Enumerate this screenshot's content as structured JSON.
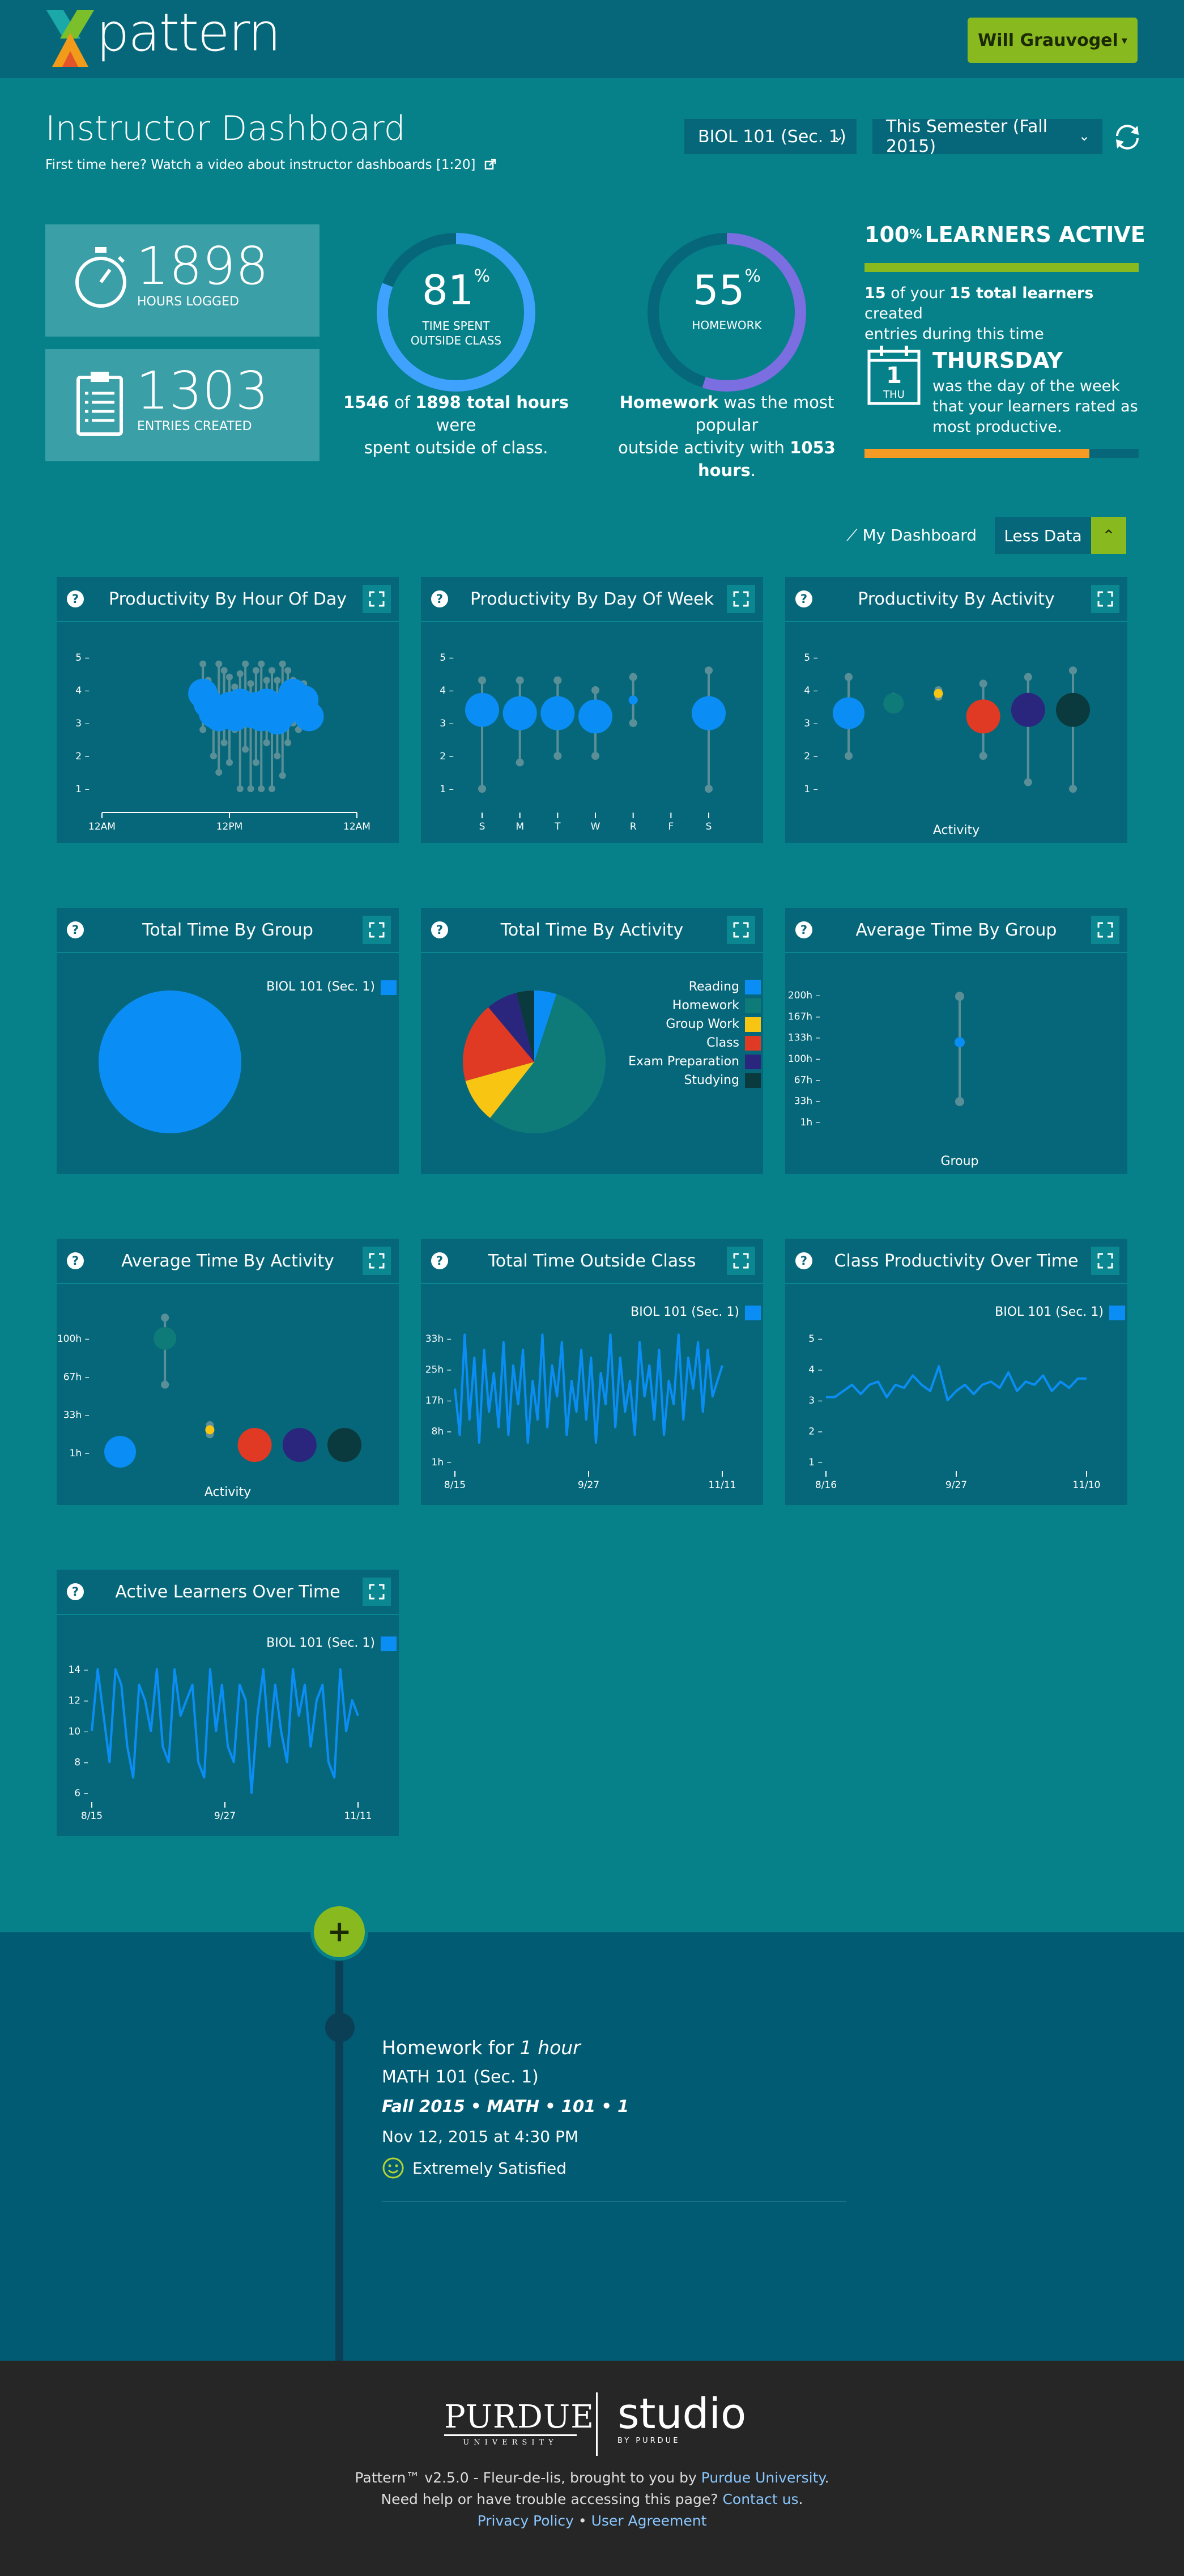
{
  "header": {
    "logo_text": "pattern",
    "user_label": "Will Grauvogel"
  },
  "page": {
    "title": "Instructor Dashboard",
    "subtitle": "First time here? Watch a video about instructor dashboards [1:20]",
    "course_select": "BIOL 101 (Sec. 1)",
    "semester_select": "This Semester (Fall 2015)"
  },
  "stats": {
    "hours_value": "1898",
    "hours_label": "HOURS LOGGED",
    "entries_value": "1303",
    "entries_label": "ENTRIES CREATED"
  },
  "donut_outside": {
    "value": "81",
    "percent": "%",
    "label_line1": "TIME SPENT",
    "label_line2": "OUTSIDE CLASS",
    "fraction": 0.81,
    "color": "#3fa2ff",
    "desc_a": "1546",
    "desc_b": " of ",
    "desc_c": "1898 total hours",
    "desc_d": " were",
    "desc_line2": "spent outside of class."
  },
  "donut_homework": {
    "value": "55",
    "percent": "%",
    "label": "HOMEWORK",
    "fraction": 0.55,
    "color": "#7a6ee0",
    "desc_a": "Homework",
    "desc_b": " was the most popular",
    "desc_c": "outside activity with ",
    "desc_d": "1053 hours",
    "desc_e": "."
  },
  "learners": {
    "pct": "100",
    "pct_sign": "%",
    "heading": "LEARNERS ACTIVE",
    "fraction": 1.0,
    "desc_a": "15",
    "desc_b": " of your ",
    "desc_c": "15 total learners",
    "desc_d": " created",
    "desc_line2": "entries during this time"
  },
  "weekday": {
    "cal_day": "1",
    "cal_label": "THU",
    "heading": "THURSDAY",
    "desc": "was the day of the week that your learners rated as most productive.",
    "fraction": 0.82
  },
  "controls": {
    "my_dashboard": "My Dashboard",
    "less_data": "Less Data",
    "collapse_icon": "chevron-up-icon"
  },
  "cards": {
    "hour": {
      "title": "Productivity By Hour Of Day",
      "yticks": [
        "5 –",
        "4 –",
        "3 –",
        "2 –",
        "1 –"
      ],
      "xticks": [
        "12AM",
        "12PM",
        "12AM"
      ]
    },
    "dow": {
      "title": "Productivity By Day Of Week",
      "yticks": [
        "5 –",
        "4 –",
        "3 –",
        "2 –",
        "1 –"
      ],
      "xticks": [
        "S",
        "M",
        "T",
        "W",
        "R",
        "F",
        "S"
      ]
    },
    "activity": {
      "title": "Productivity By Activity",
      "yticks": [
        "5 –",
        "4 –",
        "3 –",
        "2 –",
        "1 –"
      ],
      "xlabel": "Activity"
    },
    "ttgroup": {
      "title": "Total Time By Group",
      "legend": "BIOL 101 (Sec. 1)"
    },
    "ttactivity": {
      "title": "Total Time By Activity",
      "legend": [
        "Reading",
        "Homework",
        "Group Work",
        "Class",
        "Exam Preparation",
        "Studying"
      ]
    },
    "atgroup": {
      "title": "Average Time By Group",
      "yticks": [
        "200h –",
        "167h –",
        "133h –",
        "100h –",
        "67h –",
        "33h –",
        "1h –"
      ],
      "xlabel": "Group"
    },
    "atactivity": {
      "title": "Average Time By Activity",
      "yticks": [
        "100h –",
        "67h –",
        "33h –",
        "1h –"
      ],
      "xlabel": "Activity"
    },
    "ttoutside": {
      "title": "Total Time Outside Class",
      "legend": "BIOL 101 (Sec. 1)",
      "yticks": [
        "33h –",
        "25h –",
        "17h –",
        "8h –",
        "1h –"
      ],
      "xticks": [
        "8/15",
        "9/27",
        "11/11"
      ]
    },
    "productivity_time": {
      "title": "Class Productivity Over Time",
      "legend": "BIOL 101 (Sec. 1)",
      "yticks": [
        "5 –",
        "4 –",
        "3 –",
        "2 –",
        "1 –"
      ],
      "xticks": [
        "8/16",
        "9/27",
        "11/10"
      ]
    },
    "active_learners": {
      "title": "Active Learners Over Time",
      "legend": "BIOL 101 (Sec. 1)",
      "yticks": [
        "14 –",
        "12 –",
        "10 –",
        "8 –",
        "6 –"
      ],
      "xticks": [
        "8/15",
        "9/27",
        "11/11"
      ]
    }
  },
  "colors": {
    "reading": "#0a8ef5",
    "homework": "#0e7b79",
    "group_work": "#f8c513",
    "class": "#e03a24",
    "exam_prep": "#2a267e",
    "studying": "#0b3a3e",
    "accent_green": "#88b91f",
    "accent_orange": "#f59a23"
  },
  "chart_data": [
    {
      "type": "scatter",
      "title": "Productivity By Hour Of Day",
      "ylim": [
        1,
        5
      ],
      "x_range": [
        0,
        24
      ],
      "points": [
        {
          "x": 9.5,
          "y": 3.9,
          "lo": 2.8,
          "hi": 4.8
        },
        {
          "x": 10,
          "y": 3.6,
          "lo": 3.0,
          "hi": 4.3
        },
        {
          "x": 10.5,
          "y": 3.3,
          "lo": 2.0,
          "hi": 4.0
        },
        {
          "x": 11,
          "y": 3.2,
          "lo": 1.5,
          "hi": 4.8
        },
        {
          "x": 11.5,
          "y": 3.4,
          "lo": 2.4,
          "hi": 4.6
        },
        {
          "x": 12,
          "y": 3.5,
          "lo": 1.8,
          "hi": 4.4
        },
        {
          "x": 12.5,
          "y": 3.2,
          "lo": 2.8,
          "hi": 4.1
        },
        {
          "x": 13,
          "y": 3.6,
          "lo": 1.0,
          "hi": 4.5
        },
        {
          "x": 13.5,
          "y": 3.4,
          "lo": 2.2,
          "hi": 4.8
        },
        {
          "x": 14,
          "y": 3.3,
          "lo": 1.0,
          "hi": 4.2
        },
        {
          "x": 14.5,
          "y": 3.5,
          "lo": 1.8,
          "hi": 4.6
        },
        {
          "x": 15,
          "y": 3.2,
          "lo": 1.0,
          "hi": 4.8
        },
        {
          "x": 15.5,
          "y": 3.6,
          "lo": 2.4,
          "hi": 4.3
        },
        {
          "x": 16,
          "y": 3.4,
          "lo": 1.0,
          "hi": 4.6
        },
        {
          "x": 16.5,
          "y": 3.1,
          "lo": 2.0,
          "hi": 4.3
        },
        {
          "x": 17,
          "y": 3.3,
          "lo": 1.4,
          "hi": 4.8
        },
        {
          "x": 17.5,
          "y": 3.6,
          "lo": 2.4,
          "hi": 4.6
        },
        {
          "x": 18,
          "y": 3.9,
          "lo": 3.0,
          "hi": 4.3
        },
        {
          "x": 18.5,
          "y": 3.5,
          "lo": 2.8,
          "hi": 4.0
        },
        {
          "x": 19,
          "y": 3.7,
          "lo": 3.4,
          "hi": 4.2
        },
        {
          "x": 19.5,
          "y": 3.2,
          "lo": 3.0,
          "hi": 3.9
        }
      ]
    },
    {
      "type": "scatter",
      "title": "Productivity By Day Of Week",
      "categories": [
        "S",
        "M",
        "T",
        "W",
        "R",
        "F",
        "S"
      ],
      "ylim": [
        1,
        5
      ],
      "values": [
        3.4,
        3.3,
        3.3,
        3.2,
        3.7,
        null,
        3.3
      ],
      "lo": [
        1.0,
        1.8,
        2.0,
        2.0,
        3.0,
        null,
        1.0
      ],
      "hi": [
        4.3,
        4.3,
        4.3,
        4.0,
        4.4,
        null,
        4.6
      ]
    },
    {
      "type": "scatter",
      "title": "Productivity By Activity",
      "categories": [
        "Reading",
        "Homework",
        "Group Work",
        "Class",
        "Exam Preparation",
        "Studying"
      ],
      "ylim": [
        1,
        5
      ],
      "values": [
        3.3,
        3.6,
        3.9,
        3.2,
        3.4,
        3.4
      ],
      "lo": [
        2.0,
        3.5,
        3.8,
        2.0,
        1.2,
        1.0
      ],
      "hi": [
        4.4,
        3.8,
        4.0,
        4.2,
        4.4,
        4.6
      ]
    },
    {
      "type": "pie",
      "title": "Total Time By Group",
      "labels": [
        "BIOL 101 (Sec. 1)"
      ],
      "values": [
        1
      ]
    },
    {
      "type": "pie",
      "title": "Total Time By Activity",
      "labels": [
        "Reading",
        "Homework",
        "Group Work",
        "Class",
        "Exam Preparation",
        "Studying"
      ],
      "values": [
        5,
        55,
        10,
        18,
        7,
        4
      ]
    },
    {
      "type": "scatter",
      "title": "Average Time By Group",
      "categories": [
        "Group"
      ],
      "values": [
        126
      ],
      "lo": [
        33
      ],
      "hi": [
        198
      ],
      "ylim": [
        1,
        200
      ]
    },
    {
      "type": "scatter",
      "title": "Average Time By Activity",
      "categories": [
        "Reading",
        "Homework",
        "Group Work",
        "Class",
        "Exam Preparation",
        "Studying"
      ],
      "values": [
        1,
        100,
        21,
        17,
        1,
        1
      ],
      "lo": [
        null,
        60,
        17,
        null,
        null,
        null
      ],
      "hi": [
        null,
        118,
        25,
        null,
        null,
        null
      ],
      "ylim": [
        1,
        110
      ]
    },
    {
      "type": "line",
      "title": "Total Time Outside Class",
      "x_range": [
        "8/15",
        "11/11"
      ],
      "ylim": [
        1,
        36
      ],
      "series": [
        {
          "name": "BIOL 101 (Sec. 1)",
          "values": [
            20,
            8,
            34,
            12,
            28,
            6,
            30,
            14,
            24,
            10,
            32,
            8,
            26,
            16,
            30,
            6,
            22,
            12,
            34,
            10,
            26,
            18,
            32,
            8,
            22,
            14,
            30,
            12,
            28,
            6,
            24,
            16,
            34,
            10,
            28,
            14,
            22,
            8,
            32,
            18,
            26,
            12,
            30,
            8,
            22,
            16,
            34,
            12,
            28,
            20,
            32,
            14,
            30,
            18,
            22,
            26
          ]
        }
      ]
    },
    {
      "type": "line",
      "title": "Class Productivity Over Time",
      "x_range": [
        "8/16",
        "11/10"
      ],
      "ylim": [
        1,
        5
      ],
      "series": [
        {
          "name": "BIOL 101 (Sec. 1)",
          "values": [
            3.1,
            3.1,
            3.3,
            3.5,
            3.2,
            3.5,
            3.6,
            3.1,
            3.5,
            3.4,
            3.8,
            3.5,
            3.3,
            4.1,
            3.0,
            3.3,
            3.5,
            3.2,
            3.5,
            3.6,
            3.4,
            3.9,
            3.3,
            3.6,
            3.5,
            3.8,
            3.3,
            3.6,
            3.4,
            3.7,
            3.7
          ]
        }
      ]
    },
    {
      "type": "line",
      "title": "Active Learners Over Time",
      "x_range": [
        "8/15",
        "11/11"
      ],
      "ylim": [
        6,
        15
      ],
      "series": [
        {
          "name": "BIOL 101 (Sec. 1)",
          "values": [
            10,
            14,
            11,
            8,
            14,
            13,
            9,
            7,
            13,
            12,
            10,
            14,
            9,
            8,
            14,
            11,
            12,
            13,
            8,
            7,
            14,
            10,
            13,
            9,
            8,
            13,
            12,
            6,
            11,
            14,
            9,
            13,
            10,
            8,
            14,
            11,
            13,
            9,
            12,
            13,
            8,
            7,
            14,
            10,
            12,
            11
          ]
        }
      ]
    }
  ],
  "timeline": {
    "add_icon": "plus-icon",
    "entry_title_a": "Homework",
    "entry_title_b": " for ",
    "entry_title_c": "1 hour",
    "course": "MATH 101 (Sec. 1)",
    "tags": "Fall 2015 • MATH • 101 • 1",
    "date": "Nov 12, 2015 at 4:30 PM",
    "mood": "Extremely Satisfied"
  },
  "footer": {
    "purdue": "PURDUE",
    "university": "UNIVERSITY",
    "studio": "studio",
    "by_purdue": "BY PURDUE",
    "line1_a": "Pattern™ v2.5.0 - Fleur-de-lis, brought to you by ",
    "line1_link": "Purdue University",
    "line1_end": ".",
    "line2_a": "Need help or have trouble accessing this page? ",
    "line2_link": "Contact us",
    "line2_end": ".",
    "privacy": "Privacy Policy",
    "sep": " • ",
    "agreement": "User Agreement"
  }
}
